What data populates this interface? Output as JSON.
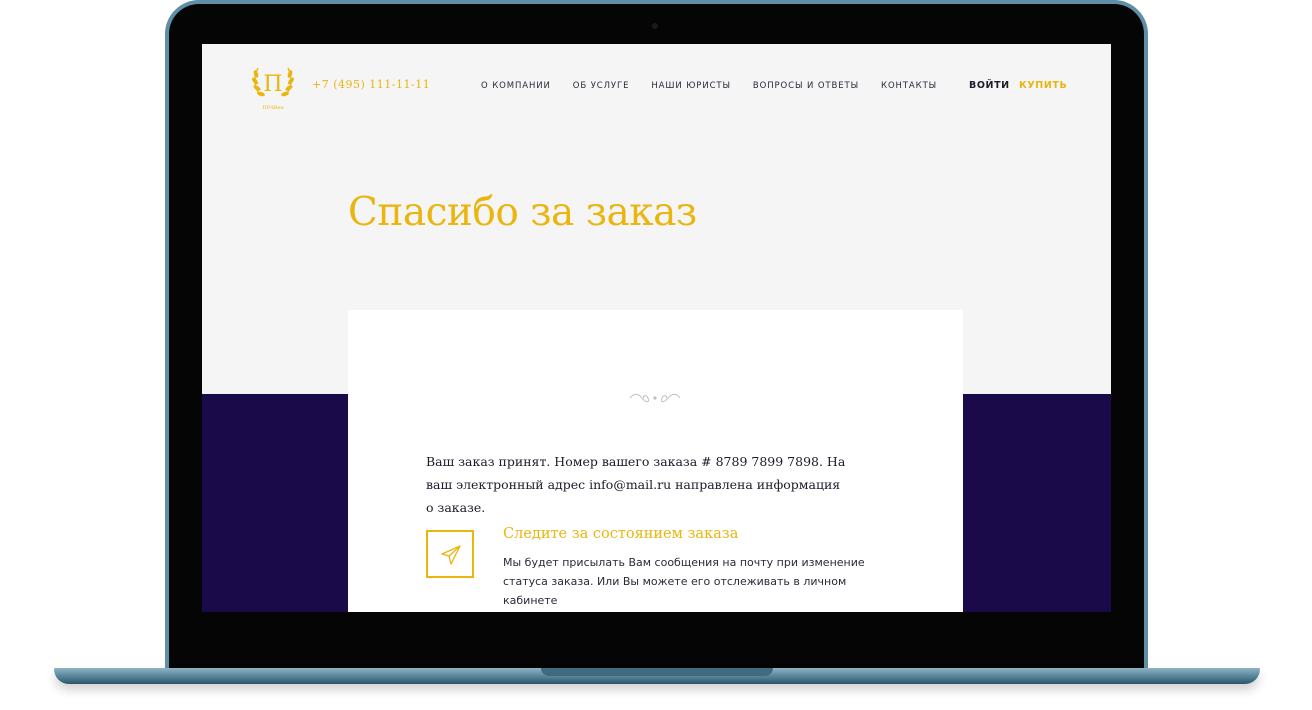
{
  "colors": {
    "accent": "#e9b50e",
    "band": "#1b0a4a",
    "frame": "#5f8fa6"
  },
  "header": {
    "logo": {
      "letter": "П",
      "caption": "ПРАВеа"
    },
    "phone": "+7 (495) 111-11-11",
    "nav": [
      {
        "label": "О компании"
      },
      {
        "label": "Об услуге"
      },
      {
        "label": "Наши юристы"
      },
      {
        "label": "Вопросы и ответы"
      },
      {
        "label": "Контакты"
      }
    ],
    "login_label": "Войти",
    "buy_label": "Купить"
  },
  "main": {
    "title": "Спасибо за заказ",
    "order_message": "Ваш заказ принят. Номер вашего заказа # 8789 7899 7898. На ваш электронный адрес info@mail.ru направлена информация о заказе.",
    "tracking": {
      "icon": "paper-plane-icon",
      "title": "Следите за состоянием заказа",
      "description": "Мы будет присылать Вам сообщения на почту при изменение статуса заказа. Или Вы можете его отслеживать в личном кабинете"
    }
  }
}
